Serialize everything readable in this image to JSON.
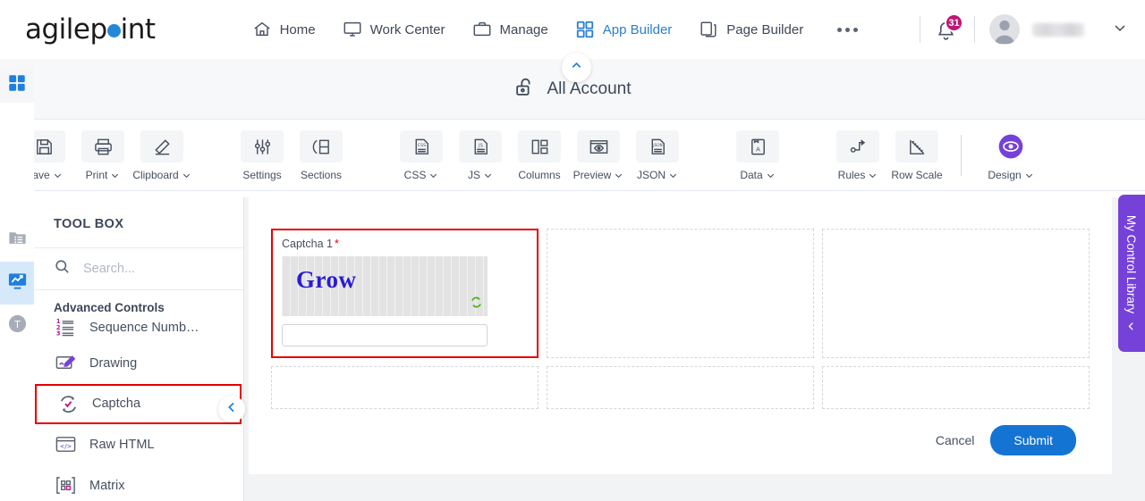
{
  "header": {
    "logo_text_a": "agilep",
    "logo_text_b": "int",
    "nav": [
      {
        "label": "Home",
        "icon": "home-icon",
        "active": false
      },
      {
        "label": "Work Center",
        "icon": "monitor-icon",
        "active": false
      },
      {
        "label": "Manage",
        "icon": "briefcase-icon",
        "active": false
      },
      {
        "label": "App Builder",
        "icon": "grid-icon",
        "active": true
      },
      {
        "label": "Page Builder",
        "icon": "copy-icon",
        "active": false
      }
    ],
    "more_label": "more-options",
    "notification_count": "31",
    "username": "",
    "badge_color": "#bd1577",
    "accent_color": "#2a7fd4"
  },
  "account_bar": {
    "label": "All Account",
    "icon": "unlock-icon",
    "collapse_icon": "chevron-up-icon"
  },
  "toolbar": {
    "buttons": [
      {
        "label": "Save",
        "icon": "save-floppy-icon",
        "caret": true
      },
      {
        "label": "Print",
        "icon": "printer-icon",
        "caret": true
      },
      {
        "label": "Clipboard",
        "icon": "pencil-icon",
        "caret": true
      },
      {
        "label": "Settings",
        "icon": "sliders-icon",
        "caret": false
      },
      {
        "label": "Sections",
        "icon": "sections-icon",
        "caret": false
      },
      {
        "label": "CSS",
        "icon": "css-file-icon",
        "caret": true
      },
      {
        "label": "JS",
        "icon": "js-file-icon",
        "caret": true
      },
      {
        "label": "Columns",
        "icon": "columns-icon",
        "caret": false
      },
      {
        "label": "Preview",
        "icon": "preview-eye-icon",
        "caret": true
      },
      {
        "label": "JSON",
        "icon": "json-file-icon",
        "caret": true
      },
      {
        "label": "Data",
        "icon": "data-book-icon",
        "caret": true
      },
      {
        "label": "Rules",
        "icon": "rules-flow-icon",
        "caret": true
      },
      {
        "label": "Row Scale",
        "icon": "ruler-icon",
        "caret": false
      },
      {
        "label": "Design",
        "icon": "design-eye-icon",
        "caret": true
      }
    ],
    "design_color": "#7641d9"
  },
  "rail": {
    "items": [
      {
        "icon": "app-grid-icon",
        "active": false
      },
      {
        "icon": "folder-list-icon",
        "active": false
      },
      {
        "icon": "chart-monitor-icon",
        "active": true
      },
      {
        "icon": "text-t-icon",
        "active": false
      }
    ]
  },
  "toolbox": {
    "title": "TOOL BOX",
    "search_placeholder": "Search...",
    "search_value": "",
    "search_icon": "search-icon",
    "group_title": "Advanced Controls",
    "collapse_icon": "chevron-left-icon",
    "items": [
      {
        "label": "Sequence Numb…",
        "icon": "sequence-number-icon",
        "selected": false
      },
      {
        "label": "Drawing",
        "icon": "drawing-pen-icon",
        "selected": false
      },
      {
        "label": "Captcha",
        "icon": "captcha-icon",
        "selected": true
      },
      {
        "label": "Raw HTML",
        "icon": "raw-html-icon",
        "selected": false
      },
      {
        "label": "Matrix",
        "icon": "matrix-icon",
        "selected": false
      }
    ],
    "selection_color": "#e50000"
  },
  "canvas": {
    "captcha": {
      "label": "Captcha 1",
      "required_marker": "*",
      "image_text": "Grow",
      "image_text_color": "#2a1ad6",
      "refresh_icon": "refresh-icon",
      "input_value": "",
      "selected": true
    },
    "empty_cells": 5,
    "cancel_label": "Cancel",
    "submit_label": "Submit",
    "submit_color": "#1474d4"
  },
  "library_tab": {
    "label": "My Control Library",
    "chevron_icon": "chevron-left-icon",
    "color": "#7641d9"
  }
}
